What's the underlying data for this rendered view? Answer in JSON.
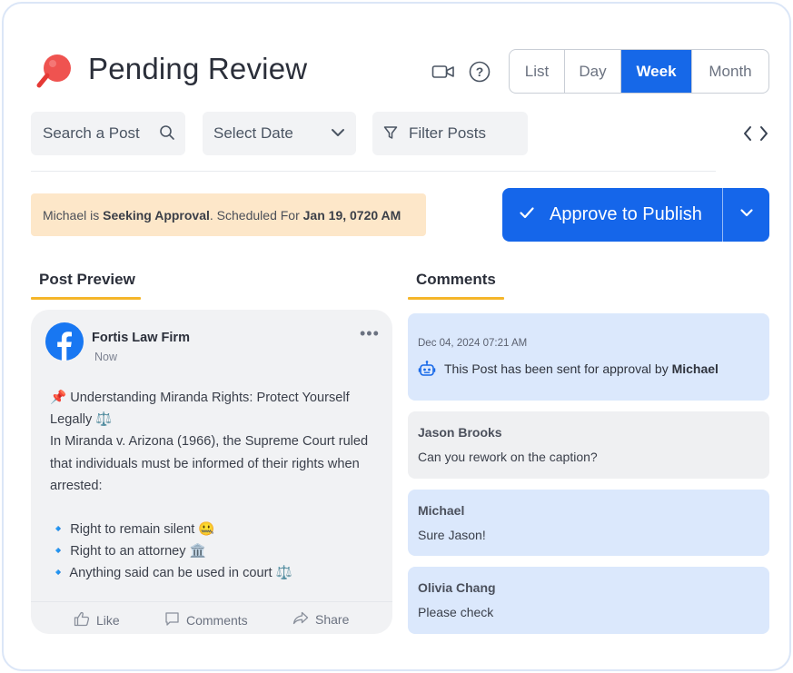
{
  "header": {
    "title": "Pending Review",
    "icons": [
      "pin-icon",
      "video-icon",
      "help-icon"
    ],
    "view_tabs": [
      {
        "label": "List",
        "active": false
      },
      {
        "label": "Day",
        "active": false
      },
      {
        "label": "Week",
        "active": true
      },
      {
        "label": "Month",
        "active": false
      }
    ]
  },
  "filters": {
    "search_placeholder": "Search a Post",
    "date_placeholder": "Select Date",
    "filter_label": "Filter Posts"
  },
  "status": {
    "user": "Michael",
    "is_text": "is",
    "state": "Seeking Approval",
    "scheduled_text": ". Scheduled For",
    "scheduled_for": "Jan 19, 0720 AM"
  },
  "approve": {
    "label": "Approve to Publish"
  },
  "tabs": {
    "post_preview": "Post Preview",
    "comments": "Comments"
  },
  "post": {
    "author": "Fortis Law Firm",
    "time": "Now",
    "lines": [
      "📌 Understanding Miranda Rights: Protect Yourself",
      "Legally ⚖️",
      "In Miranda v. Arizona (1966), the Supreme Court ruled",
      "that individuals must be informed of their rights when",
      "arrested:",
      "",
      "🔹 Right to remain silent 🤐",
      "🔹 Right to an attorney 🏛️",
      "🔹 Anything said can be used in court ⚖️"
    ],
    "actions": {
      "like": "Like",
      "comments": "Comments",
      "share": "Share"
    }
  },
  "comments": {
    "system": {
      "date": "Dec 04, 2024 07:21 AM",
      "text": "This Post has been sent for approval by",
      "by": "Michael"
    },
    "items": [
      {
        "name": "Jason Brooks",
        "text": "Can you rework on the caption?"
      },
      {
        "name": "Michael",
        "text": "Sure Jason!"
      },
      {
        "name": "Olivia Chang",
        "text": "Please check"
      }
    ]
  },
  "colors": {
    "accent": "#1668e8",
    "tab_underline": "#f5b62a",
    "banner_bg": "#fde7c9",
    "comment_blue": "#dbe8fc",
    "comment_gray": "#eff0f2"
  }
}
